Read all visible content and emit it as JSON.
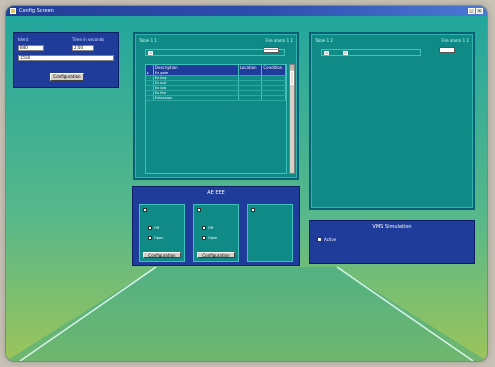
{
  "window": {
    "title": "Config Screen"
  },
  "form": {
    "label_a": "Ident",
    "label_b": "Time in seconds",
    "value_a": "B40",
    "value_b": "2:00",
    "value_long": "1550",
    "button_label": "Configuration"
  },
  "list_panel": {
    "header_left": "Table 1 1",
    "header_right": "Fire alarm 1 1",
    "columns": [
      "",
      "Description",
      "Location",
      "Condition"
    ],
    "rows": [
      {
        "c1": "Ex gate",
        "c2": "",
        "c3": "",
        "selected": true
      },
      {
        "c1": "Ex bay",
        "c2": "",
        "c3": "",
        "selected": false
      },
      {
        "c1": "Ex out",
        "c2": "",
        "c3": "",
        "selected": false
      },
      {
        "c1": "Ex low",
        "c2": "",
        "c3": "",
        "selected": false
      },
      {
        "c1": "Ex fire",
        "c2": "",
        "c3": "",
        "selected": false
      },
      {
        "c1": "Extension",
        "c2": "",
        "c3": "",
        "selected": false
      }
    ]
  },
  "right_panel": {
    "header_left": "Table 1 2",
    "header_right": "Fire alarm 1 2"
  },
  "drop_panel": {
    "title": "AE EEE",
    "card1_opt1": "Off",
    "card1_opt2": "Open",
    "card1_button": "Configuration",
    "card2_opt1": "Off",
    "card2_opt2": "Open",
    "card2_button": "Configuration"
  },
  "status_panel": {
    "title": "VMS Simulation",
    "check_label": "Active"
  }
}
